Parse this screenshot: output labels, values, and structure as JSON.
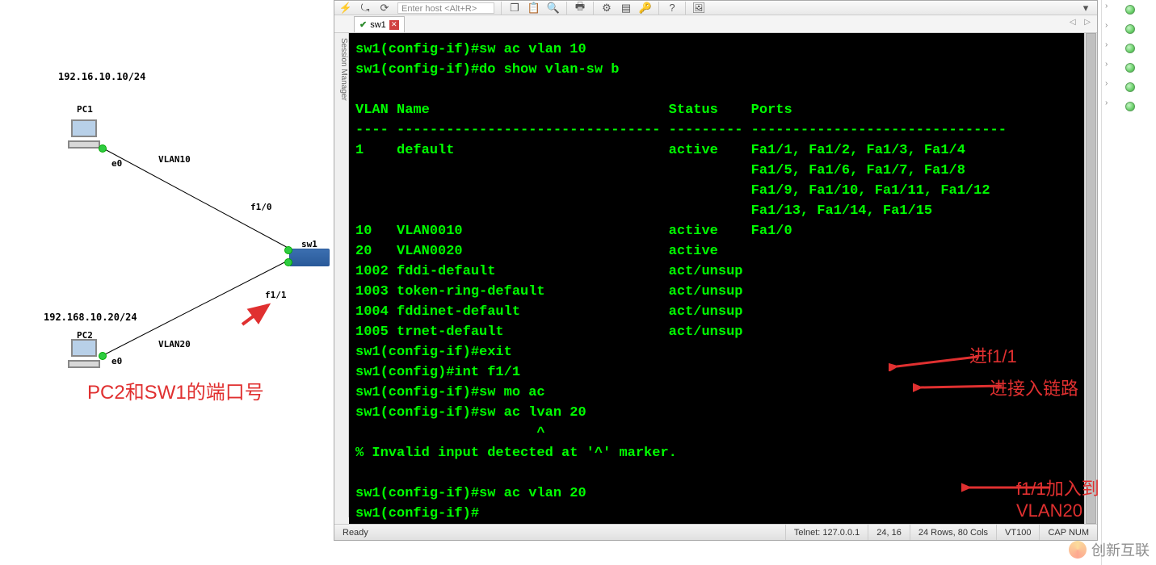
{
  "topology": {
    "subnet1": "192.16.10.10/24",
    "pc1": "PC1",
    "pc1_iface": "e0",
    "vlan10": "VLAN10",
    "f10": "f1/0",
    "sw1": "sw1",
    "f11": "f1/1",
    "subnet2": "192.168.10.20/24",
    "pc2": "PC2",
    "pc2_iface": "e0",
    "vlan20": "VLAN20",
    "note_pc2": "PC2和SW1的端口号"
  },
  "toolbar": {
    "host_placeholder": "Enter host <Alt+R>"
  },
  "tabs": {
    "tab1": "sw1"
  },
  "session_mgr_label": "Session Manager",
  "terminal_lines": [
    "sw1(config-if)#sw ac vlan 10",
    "sw1(config-if)#do show vlan-sw b",
    "",
    "VLAN Name                             Status    Ports",
    "---- -------------------------------- --------- -------------------------------",
    "1    default                          active    Fa1/1, Fa1/2, Fa1/3, Fa1/4",
    "                                                Fa1/5, Fa1/6, Fa1/7, Fa1/8",
    "                                                Fa1/9, Fa1/10, Fa1/11, Fa1/12",
    "                                                Fa1/13, Fa1/14, Fa1/15",
    "10   VLAN0010                         active    Fa1/0",
    "20   VLAN0020                         active",
    "1002 fddi-default                     act/unsup",
    "1003 token-ring-default               act/unsup",
    "1004 fddinet-default                  act/unsup",
    "1005 trnet-default                    act/unsup",
    "sw1(config-if)#exit",
    "sw1(config)#int f1/1",
    "sw1(config-if)#sw mo ac",
    "sw1(config-if)#sw ac lvan 20",
    "                      ^",
    "% Invalid input detected at '^' marker.",
    "",
    "sw1(config-if)#sw ac vlan 20",
    "sw1(config-if)#"
  ],
  "annotations": {
    "a1": "进f1/1",
    "a2": "进接入链路",
    "a3": "f1/1加入到VLAN20"
  },
  "statusbar": {
    "ready": "Ready",
    "conn": "Telnet: 127.0.0.1",
    "pos": "24, 16",
    "size": "24 Rows, 80 Cols",
    "term": "VT100",
    "caps": "CAP NUM"
  },
  "watermark_text": "创新互联"
}
